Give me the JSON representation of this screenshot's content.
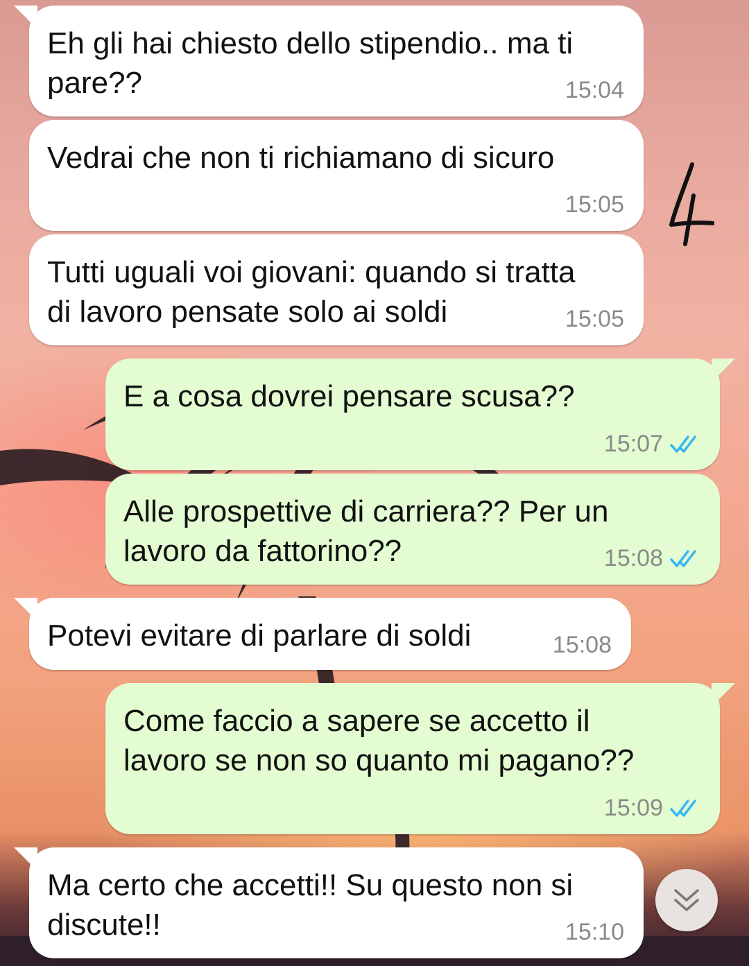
{
  "messages": [
    {
      "direction": "in",
      "text": "Eh gli hai chiesto dello stipendio.. ma ti\npare??",
      "time": "15:04"
    },
    {
      "direction": "in",
      "text": "Vedrai che non ti richiamano di sicuro",
      "time": "15:05"
    },
    {
      "direction": "in",
      "text": "Tutti uguali voi giovani: quando si tratta\ndi lavoro pensate solo ai soldi",
      "time": "15:05"
    },
    {
      "direction": "out",
      "text": "E a cosa dovrei pensare scusa??",
      "time": "15:07",
      "status": "read"
    },
    {
      "direction": "out",
      "text": "Alle prospettive di carriera?? Per un\nlavoro da fattorino??",
      "time": "15:08",
      "status": "read"
    },
    {
      "direction": "in",
      "text": "Potevi evitare di parlare di soldi",
      "time": "15:08"
    },
    {
      "direction": "out",
      "text": "Come faccio a sapere se accetto il\nlavoro se non so quanto mi pagano??",
      "time": "15:09",
      "status": "read"
    },
    {
      "direction": "in",
      "text": "Ma certo che accetti!! Su questo non si\ndiscute!!",
      "time": "15:10"
    }
  ],
  "annotation": "4",
  "icons": {
    "read_receipt": "double-check-icon",
    "scroll_down": "chevron-double-down-icon"
  },
  "colors": {
    "incoming_bubble": "#ffffff",
    "outgoing_bubble": "#e3fcd1",
    "read_tick": "#34b7f1",
    "timestamp": "#8a8a8a"
  }
}
